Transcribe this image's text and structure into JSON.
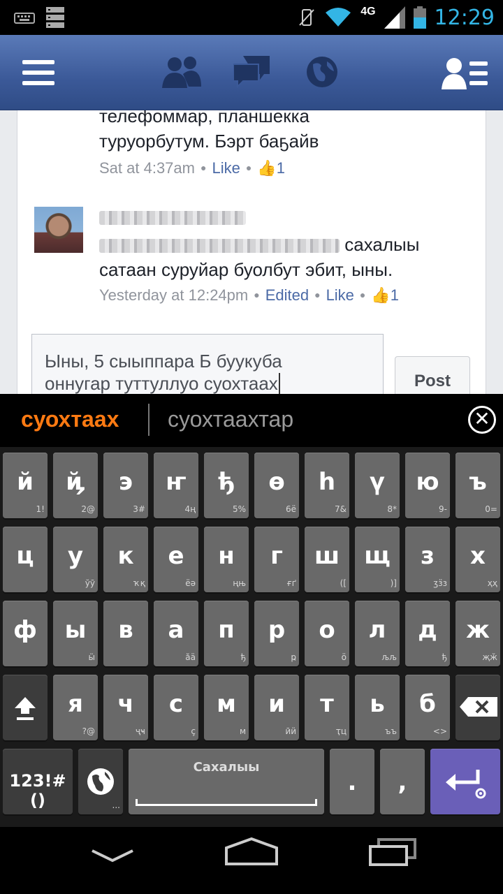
{
  "status": {
    "time": "12:29",
    "network": "4G",
    "icons": [
      "keyboard-icon",
      "storage-icon",
      "vibrate-off-icon",
      "wifi-icon",
      "signal-icon",
      "battery-icon"
    ]
  },
  "fb": {
    "icons": [
      "menu-icon",
      "friends-icon",
      "messages-icon",
      "notifications-globe-icon",
      "profile-list-icon"
    ]
  },
  "comments": [
    {
      "lines": [
        "телефоммар, планшекка",
        "туруорбутум. Бэрт баҕайв"
      ],
      "time": "Sat at 4:37am",
      "edited": "",
      "like": "Like",
      "likes": "1"
    },
    {
      "lines": [
        "сахалыы",
        "сатаан суруйар буолбут эбит, ыны."
      ],
      "time": "Yesterday at 12:24pm",
      "edited": "Edited",
      "like": "Like",
      "likes": "1"
    }
  ],
  "composer": {
    "line1": "Ыны, 5 сыыппара Б буукуба",
    "line2_prefix": "оннугар туттуллуо ",
    "line2_word": "суохтаах",
    "post": "Post"
  },
  "keyboard": {
    "suggestions": [
      "суохтаах",
      "суохтаахтар"
    ],
    "row1": [
      [
        "й",
        "1!"
      ],
      [
        "ҋ",
        "2@"
      ],
      [
        "э",
        "3#"
      ],
      [
        "ҥ",
        "4ң"
      ],
      [
        "ђ",
        "5%"
      ],
      [
        "ө",
        "6ё"
      ],
      [
        "һ",
        "7&"
      ],
      [
        "ү",
        "8*"
      ],
      [
        "ю",
        "9-"
      ],
      [
        "ъ",
        "0="
      ]
    ],
    "row2": [
      [
        "ц",
        ""
      ],
      [
        "у",
        "ўӯ"
      ],
      [
        "к",
        "ҡқ"
      ],
      [
        "е",
        "ёә"
      ],
      [
        "н",
        "ңњ"
      ],
      [
        "г",
        "ғґ"
      ],
      [
        "ш",
        "(["
      ],
      [
        "щ",
        ")]"
      ],
      [
        "з",
        "ӡӟз"
      ],
      [
        "х",
        "ҳҳ"
      ]
    ],
    "row3": [
      [
        "ф",
        ""
      ],
      [
        "ы",
        "ӹ"
      ],
      [
        "в",
        ""
      ],
      [
        "а",
        "ӑӓ"
      ],
      [
        "п",
        "ђ"
      ],
      [
        "р",
        "ҏ"
      ],
      [
        "о",
        "ӧ"
      ],
      [
        "л",
        "љљ"
      ],
      [
        "д",
        "ђ"
      ],
      [
        "ж",
        "җӂ"
      ]
    ],
    "row4": [
      [
        "я",
        "?@"
      ],
      [
        "ч",
        "ҷҹ"
      ],
      [
        "с",
        "ç"
      ],
      [
        "м",
        "м"
      ],
      [
        "и",
        "ӣӥ"
      ],
      [
        "т",
        "ҭц"
      ],
      [
        "ь",
        "ъъ"
      ],
      [
        "б",
        "<>"
      ]
    ],
    "symbols_label": "123!#()",
    "space_label": "Сахалыы",
    "period": ".",
    "comma": ","
  }
}
